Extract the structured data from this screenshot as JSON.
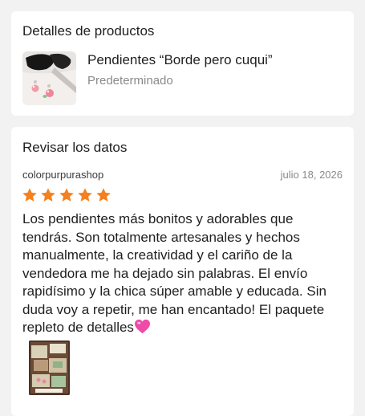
{
  "product_section": {
    "title": "Detalles de productos",
    "product_name": "Pendientes “Borde pero cuqui”",
    "variant": "Predeterminado"
  },
  "review_section": {
    "title": "Revisar los datos",
    "shop_name": "colorpurpurashop",
    "date": "julio 18, 2026",
    "rating": 5,
    "rating_max": 5,
    "text": "Los pendientes más bonitos y adorables que tendrás. Son totalmente artesanales y hechos manualmente, la creatividad y el cariño de la vendedora me ha dejado sin palabras. El envío rapidísimo y la chica súper amable y educada. Sin duda voy a repetir, me han encantado! El paquete repleto de detalles",
    "emoji": "pink-heart-icon",
    "photo_count": 1
  },
  "colors": {
    "star": "#f5801f",
    "heart": "#f04aa8",
    "card_bg": "#ffffff",
    "page_bg": "#f2f2f2",
    "muted_text": "#8a8a8a"
  }
}
